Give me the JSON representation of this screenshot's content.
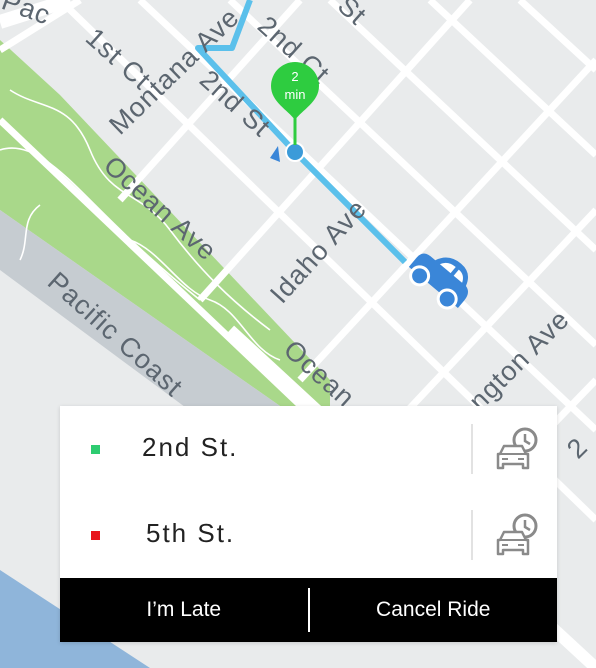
{
  "map": {
    "streets": {
      "pacific": "Pac",
      "first_ct": "1st Ct",
      "montana": "Montana Ave",
      "second_ct": "2nd Ct",
      "st_fragment": "St",
      "second_st": "2nd St",
      "ocean_top": "Ocean Ave",
      "idaho": "Idaho Ave",
      "pch": "Pacific Coast",
      "ocean_bottom": "Ocean",
      "washington": "ngton Ave",
      "edge_fragment": "2"
    },
    "eta_pin": {
      "value": "2",
      "unit": "min",
      "color": "#2ecc40"
    },
    "route_color": "#5bc0eb",
    "car_icon": "car-icon",
    "car_color": "#3a86d8"
  },
  "panel": {
    "stops": [
      {
        "label": "2nd St.",
        "marker_color": "#2ecc71",
        "icon": "scheduled-car-icon"
      },
      {
        "label": "5th St.",
        "marker_color": "#e8141b",
        "icon": "scheduled-car-icon"
      }
    ],
    "actions": {
      "late_label": "I’m Late",
      "cancel_label": "Cancel Ride"
    }
  }
}
